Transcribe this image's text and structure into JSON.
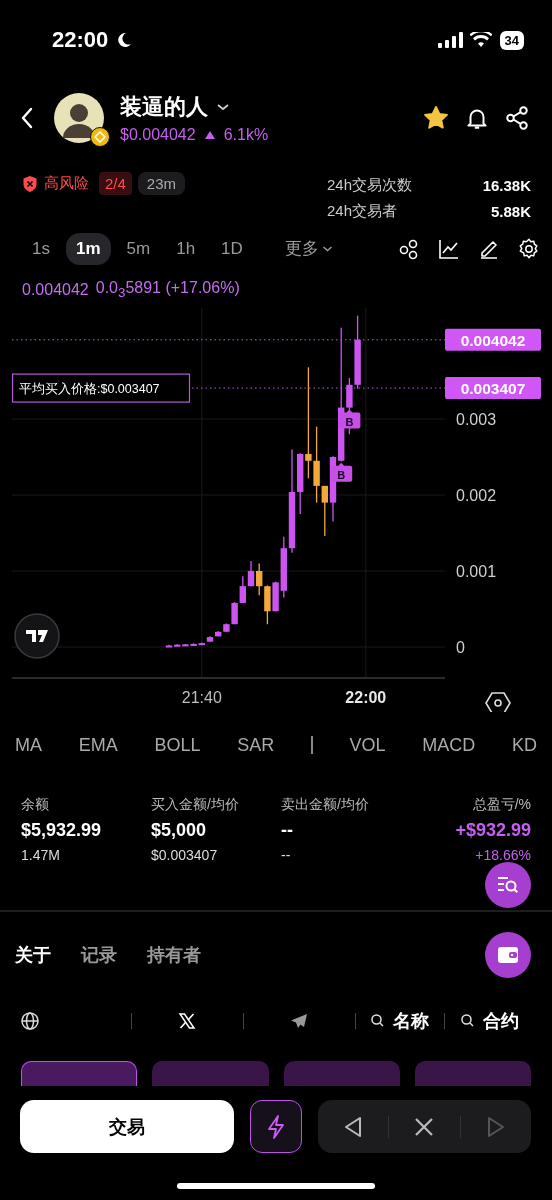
{
  "status_bar": {
    "time": "22:00",
    "battery": "34"
  },
  "header": {
    "token_name": "装逼的人",
    "price": "$0.004042",
    "change": "6.1k%",
    "favorite": true
  },
  "risk": {
    "label": "高风险",
    "score": "2/4",
    "age": "23m"
  },
  "stats": [
    {
      "label": "24h交易次数",
      "value": "16.38K"
    },
    {
      "label": "24h交易者",
      "value": "5.88K"
    }
  ],
  "intervals": [
    {
      "label": "1s",
      "selected": false,
      "kind": "interval"
    },
    {
      "label": "1m",
      "selected": true,
      "kind": "interval"
    },
    {
      "label": "5m",
      "selected": false,
      "kind": "interval"
    },
    {
      "label": "1h",
      "selected": false,
      "kind": "interval"
    },
    {
      "label": "1D",
      "selected": false,
      "kind": "interval"
    },
    {
      "label": "更多",
      "selected": false,
      "kind": "menu"
    }
  ],
  "quote": {
    "price": "0.004042",
    "change": "0.0$_{3}$5891 (+17.06%)"
  },
  "chart": {
    "y_axis_labels": [
      "0.003",
      "0.002",
      "0.001",
      "0"
    ],
    "x_axis_labels": [
      "21:40",
      "22:00"
    ],
    "price_tags": [
      {
        "kind": "current",
        "label": "0.004042"
      },
      {
        "kind": "average",
        "label": "0.003407",
        "note": "平均买入价格:$0.003407"
      }
    ],
    "trade_markers": [
      "B",
      "B"
    ]
  },
  "indicator_groups": [
    [
      "MA",
      "EMA",
      "BOLL",
      "SAR"
    ],
    [
      "VOL",
      "MACD",
      "KD"
    ]
  ],
  "position": [
    {
      "kind": "plain",
      "label": "余额",
      "value": "$5,932.99",
      "sub": "1.47M"
    },
    {
      "kind": "plain",
      "label": "买入金额/均价",
      "value": "$5,000",
      "sub": "$0.003407"
    },
    {
      "kind": "plain",
      "label": "卖出金额/均价",
      "value": "--",
      "sub": "--"
    },
    {
      "kind": "pnl",
      "label": "总盈亏/%",
      "value": "+$932.99",
      "sub": "+18.66%"
    }
  ],
  "tabs": [
    {
      "label": "关于",
      "selected": true
    },
    {
      "label": "记录",
      "selected": false
    },
    {
      "label": "持有者",
      "selected": false
    }
  ],
  "links": [
    {
      "kind": "website"
    },
    {
      "kind": "x"
    },
    {
      "kind": "telegram"
    },
    {
      "kind": "search",
      "label": "名称"
    },
    {
      "kind": "search",
      "label": "合约"
    }
  ],
  "periods": [
    {
      "selected": true
    },
    {
      "selected": false
    },
    {
      "selected": false
    },
    {
      "selected": false
    }
  ],
  "bottom_bar": {
    "trade_button": "交易",
    "nav": [
      {
        "kind": "prev",
        "disabled": false
      },
      {
        "kind": "close",
        "disabled": false
      },
      {
        "kind": "next",
        "disabled": true
      }
    ]
  }
}
